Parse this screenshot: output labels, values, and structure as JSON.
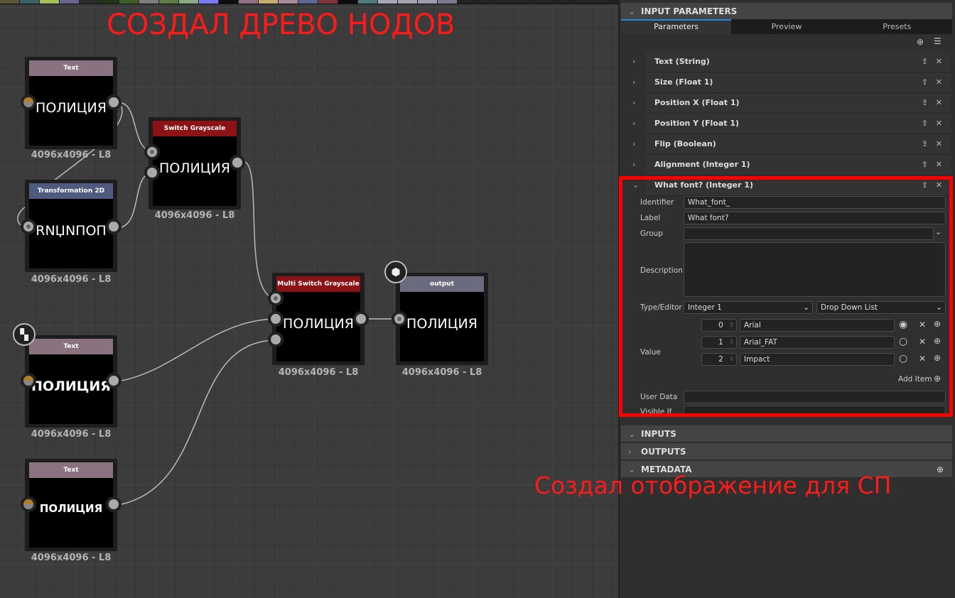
{
  "swatch_colors": [
    "#5a5737",
    "#3a6264",
    "#a5bf5c",
    "#6c6290",
    "#2b2b2b",
    "#233218",
    "#3f5e25",
    "#7d7d7d",
    "#5f7b48",
    "#8aaa86",
    "#7a7af8",
    "#0e0e0e",
    "#8e7087",
    "#c9ab6c",
    "#a78c9a",
    "#5a6893",
    "#83343f",
    "#0d0d0d",
    "#4e7a7a",
    "#a8a7b8",
    "#a4a4b1",
    "#9d9daf",
    "#7a7a8a"
  ],
  "graph": {
    "annotation": "СОЗДАЛ ДРЕВО НОДОВ",
    "nodes": [
      {
        "title": "Text",
        "header_color": "#8a7280",
        "preview": "ПОЛИЦИЯ",
        "resolution": "4096x4096 - L8"
      },
      {
        "title": "Transformation 2D",
        "header_color": "#4f5b7e",
        "preview": "RNЏNПОП",
        "resolution": "4096x4096 - L8"
      },
      {
        "title": "Switch Grayscale",
        "header_color": "#8b1215",
        "preview": "ПОЛИЦИЯ",
        "resolution": "4096x4096 - L8"
      },
      {
        "title": "Text",
        "header_color": "#8a7280",
        "preview": "ПОЛИЦИЯ",
        "resolution": "4096x4096 - L8"
      },
      {
        "title": "Text",
        "header_color": "#8a7280",
        "preview": "ПОЛИЦИЯ",
        "resolution": "4096x4096 - L8"
      },
      {
        "title": "Multi Switch Grayscale",
        "header_color": "#8b1215",
        "preview": "ПОЛИЦИЯ",
        "resolution": "4096x4096 - L8"
      },
      {
        "title": "output",
        "header_color": "#6b6a7e",
        "preview": "ПОЛИЦИЯ",
        "resolution": "4096x4096 - L8"
      }
    ]
  },
  "panel": {
    "header": "INPUT PARAMETERS",
    "tabs": [
      "Parameters",
      "Preview",
      "Presets"
    ],
    "params": [
      "Text (String)",
      "Size (Float 1)",
      "Position X (Float 1)",
      "Position Y (Float 1)",
      "Flip (Boolean)",
      "Alignment (Integer 1)",
      "What font? (Integer 1)"
    ],
    "fields": {
      "identifier_label": "Identifier",
      "identifier": "What_font_",
      "label_label": "Label",
      "label": "What font?",
      "group_label": "Group",
      "group": "",
      "description_label": "Description",
      "description": "",
      "type_label": "Type/Editor",
      "type": "Integer 1",
      "editor": "Drop Down List",
      "value_label": "Value",
      "values": [
        {
          "index": "0",
          "name": "Arial",
          "default": true
        },
        {
          "index": "1",
          "name": "Arial_FAT",
          "default": false
        },
        {
          "index": "2",
          "name": "Impact",
          "default": false
        }
      ],
      "add_item": "Add Item",
      "user_data_label": "User Data",
      "user_data": "",
      "visible_if_label": "Visible If",
      "visible_if": ""
    },
    "sections": [
      "INPUTS",
      "OUTPUTS",
      "METADATA"
    ],
    "annotation": "Создал отображение для СП",
    "highlight_color": "#ff0000"
  }
}
